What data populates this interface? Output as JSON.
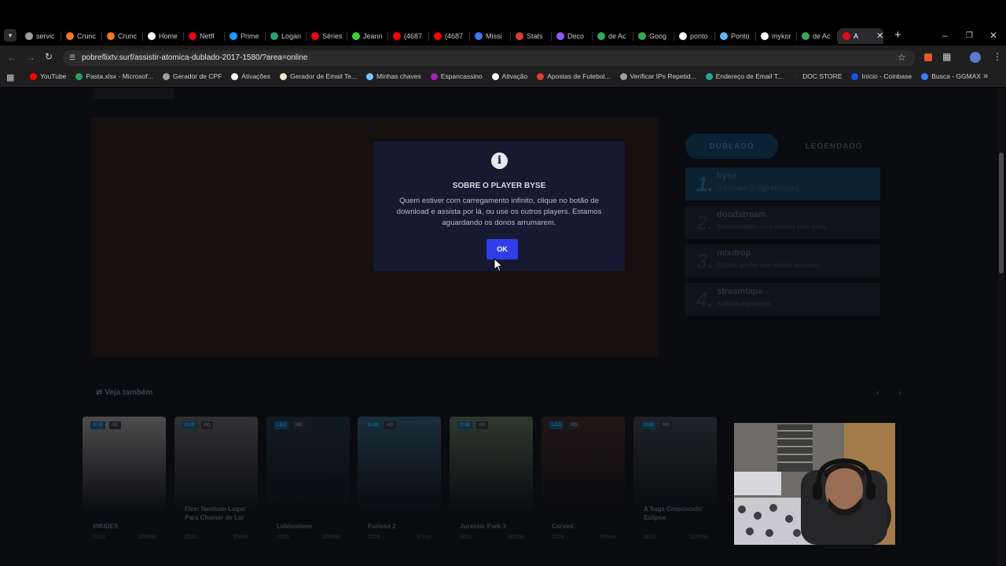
{
  "browser": {
    "tabs": [
      {
        "label": "servic",
        "color": "#9e9e9e"
      },
      {
        "label": "Crunc",
        "color": "#f47521"
      },
      {
        "label": "Crunc",
        "color": "#f47521"
      },
      {
        "label": "Home",
        "color": "#ffffff"
      },
      {
        "label": "Netfl",
        "color": "#e50914"
      },
      {
        "label": "Prime",
        "color": "#1a98ff"
      },
      {
        "label": "Logan",
        "color": "#2e9e6e"
      },
      {
        "label": "Séries",
        "color": "#e50914"
      },
      {
        "label": "Jeann",
        "color": "#3ad13a"
      },
      {
        "label": "(4687",
        "color": "#ff0000"
      },
      {
        "label": "(4687",
        "color": "#ff0000"
      },
      {
        "label": "Missi",
        "color": "#3b7bff"
      },
      {
        "label": "Stats",
        "color": "#e53935"
      },
      {
        "label": "Deco",
        "color": "#8b5cf6"
      },
      {
        "label": "de Ac",
        "color": "#34a853"
      },
      {
        "label": "Goog",
        "color": "#34a853"
      },
      {
        "label": "ponto",
        "color": "#ffffff"
      },
      {
        "label": "Ponto",
        "color": "#64b5f6"
      },
      {
        "label": "mykor",
        "color": "#ffffff"
      },
      {
        "label": "de Ac",
        "color": "#34a853"
      },
      {
        "label": "A",
        "color": "#e50914",
        "active": true
      }
    ],
    "new_tab": "+",
    "url": "pobreflixtv.surf/assistir-atomica-dublado-2017-1580/?area=online",
    "bookmarks": [
      {
        "label": "YouTube",
        "color": "#ff0000"
      },
      {
        "label": "Pasta.xlsx - Microsof...",
        "color": "#21a366"
      },
      {
        "label": "Gerador de CPF",
        "color": "#9e9e9e"
      },
      {
        "label": "Ativações",
        "color": "#ffffff"
      },
      {
        "label": "Gerador de Email Te...",
        "color": "#f0e6c8"
      },
      {
        "label": "Minhas chaves",
        "color": "#7cc4ff"
      },
      {
        "label": "Espancassino",
        "color": "#9c27b0"
      },
      {
        "label": "Ativação",
        "color": "#ffffff"
      },
      {
        "label": "Apostas de Futebol...",
        "color": "#e53935"
      },
      {
        "label": "Verificar IPs Repetid...",
        "color": "#9e9e9e"
      },
      {
        "label": "Endereço de Email T...",
        "color": "#26a69a"
      },
      {
        "label": "DOC STORE",
        "color": "#222222"
      },
      {
        "label": "Início - Coinbase",
        "color": "#1652f0"
      },
      {
        "label": "Busca - GGMAX",
        "color": "#3b7bff"
      }
    ]
  },
  "servers": {
    "tab_dubbed": "DUBLADO",
    "tab_subtitled": "LEGENDADO",
    "list": [
      {
        "num": "1.",
        "name": "byse",
        "desc": "O Principal (Antigo Filemoon)"
      },
      {
        "num": "2.",
        "name": "doodstream",
        "desc": "Recomendado para internet mais lenta."
      },
      {
        "num": "3.",
        "name": "mixdrop",
        "desc": "Rápido, porém com muitos anúncios."
      },
      {
        "num": "4.",
        "name": "streamtape",
        "desc": "A última esperança."
      }
    ]
  },
  "see_also": {
    "heading": "Veja também",
    "cards": [
      {
        "badge1": "DUB",
        "badge2": "HD",
        "title": "#NUDES",
        "year": "2018",
        "duration": "100min",
        "color": "#c9c5c0"
      },
      {
        "badge1": "DUB",
        "badge2": "HD",
        "title": "Flee: Nenhum Lugar Para Chamar de Lar",
        "year": "2021",
        "duration": "89min",
        "color": "#7a7a78"
      },
      {
        "badge1": "LEG",
        "badge2": "HD",
        "title": "Lobisomem",
        "year": "2025",
        "duration": "103min",
        "color": "#1d3a40"
      },
      {
        "badge1": "DUB",
        "badge2": "HD",
        "title": "Furiosa 2",
        "year": "2025",
        "duration": "97min",
        "color": "#3a6f8a"
      },
      {
        "badge1": "DUB",
        "badge2": "HD",
        "title": "Jurassic Park 3",
        "year": "2001",
        "duration": "92min",
        "color": "#6f8f6a"
      },
      {
        "badge1": "LEG",
        "badge2": "HD",
        "title": "Carved",
        "year": "2024",
        "duration": "94min",
        "color": "#4a2a22"
      },
      {
        "badge1": "DUB",
        "badge2": "HD",
        "title": "A Saga Crepúsculo: Eclipse",
        "year": "2010",
        "duration": "124min",
        "color": "#4a4e55"
      }
    ]
  },
  "modal": {
    "icon": "info-icon",
    "title": "SOBRE O PLAYER BYSE",
    "body": "Quem estiver com carregamento infinito, clique no botão de download e assista por lá, ou use os outros players. Estamos aguardando os donos arrumarem.",
    "ok_label": "OK",
    "accent": "#2f3ee8"
  }
}
